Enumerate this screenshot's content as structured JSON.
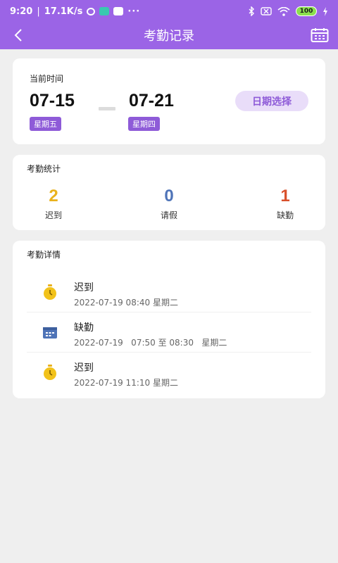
{
  "status_bar": {
    "time": "9:20",
    "speed": "17.1K/s",
    "more": "···",
    "battery": "100"
  },
  "nav": {
    "title": "考勤记录"
  },
  "current_time": {
    "label": "当前时间",
    "start_date": "07-15",
    "start_weekday": "星期五",
    "end_date": "07-21",
    "end_weekday": "星期四",
    "select_label": "日期选择"
  },
  "stats": {
    "title": "考勤统计",
    "items": [
      {
        "value": "2",
        "label": "迟到",
        "color": "#e9b21d"
      },
      {
        "value": "0",
        "label": "请假",
        "color": "#4f74b8"
      },
      {
        "value": "1",
        "label": "缺勤",
        "color": "#d9512c"
      }
    ]
  },
  "details": {
    "title": "考勤详情",
    "records": [
      {
        "icon": "stopwatch-icon",
        "type": "迟到",
        "info": "2022-07-19 08:40 星期二"
      },
      {
        "icon": "calendar-icon",
        "type": "缺勤",
        "info": "2022-07-19   07:50 至 08:30   星期二"
      },
      {
        "icon": "stopwatch-icon",
        "type": "迟到",
        "info": "2022-07-19 11:10 星期二"
      }
    ]
  },
  "colors": {
    "header": "#9b64e6",
    "accent": "#8e5bd8",
    "accent_light": "#e9ddf9",
    "late": "#e9b21d",
    "leave": "#4f74b8",
    "absent": "#d9512c",
    "calendar_icon": "#4f74b8"
  }
}
